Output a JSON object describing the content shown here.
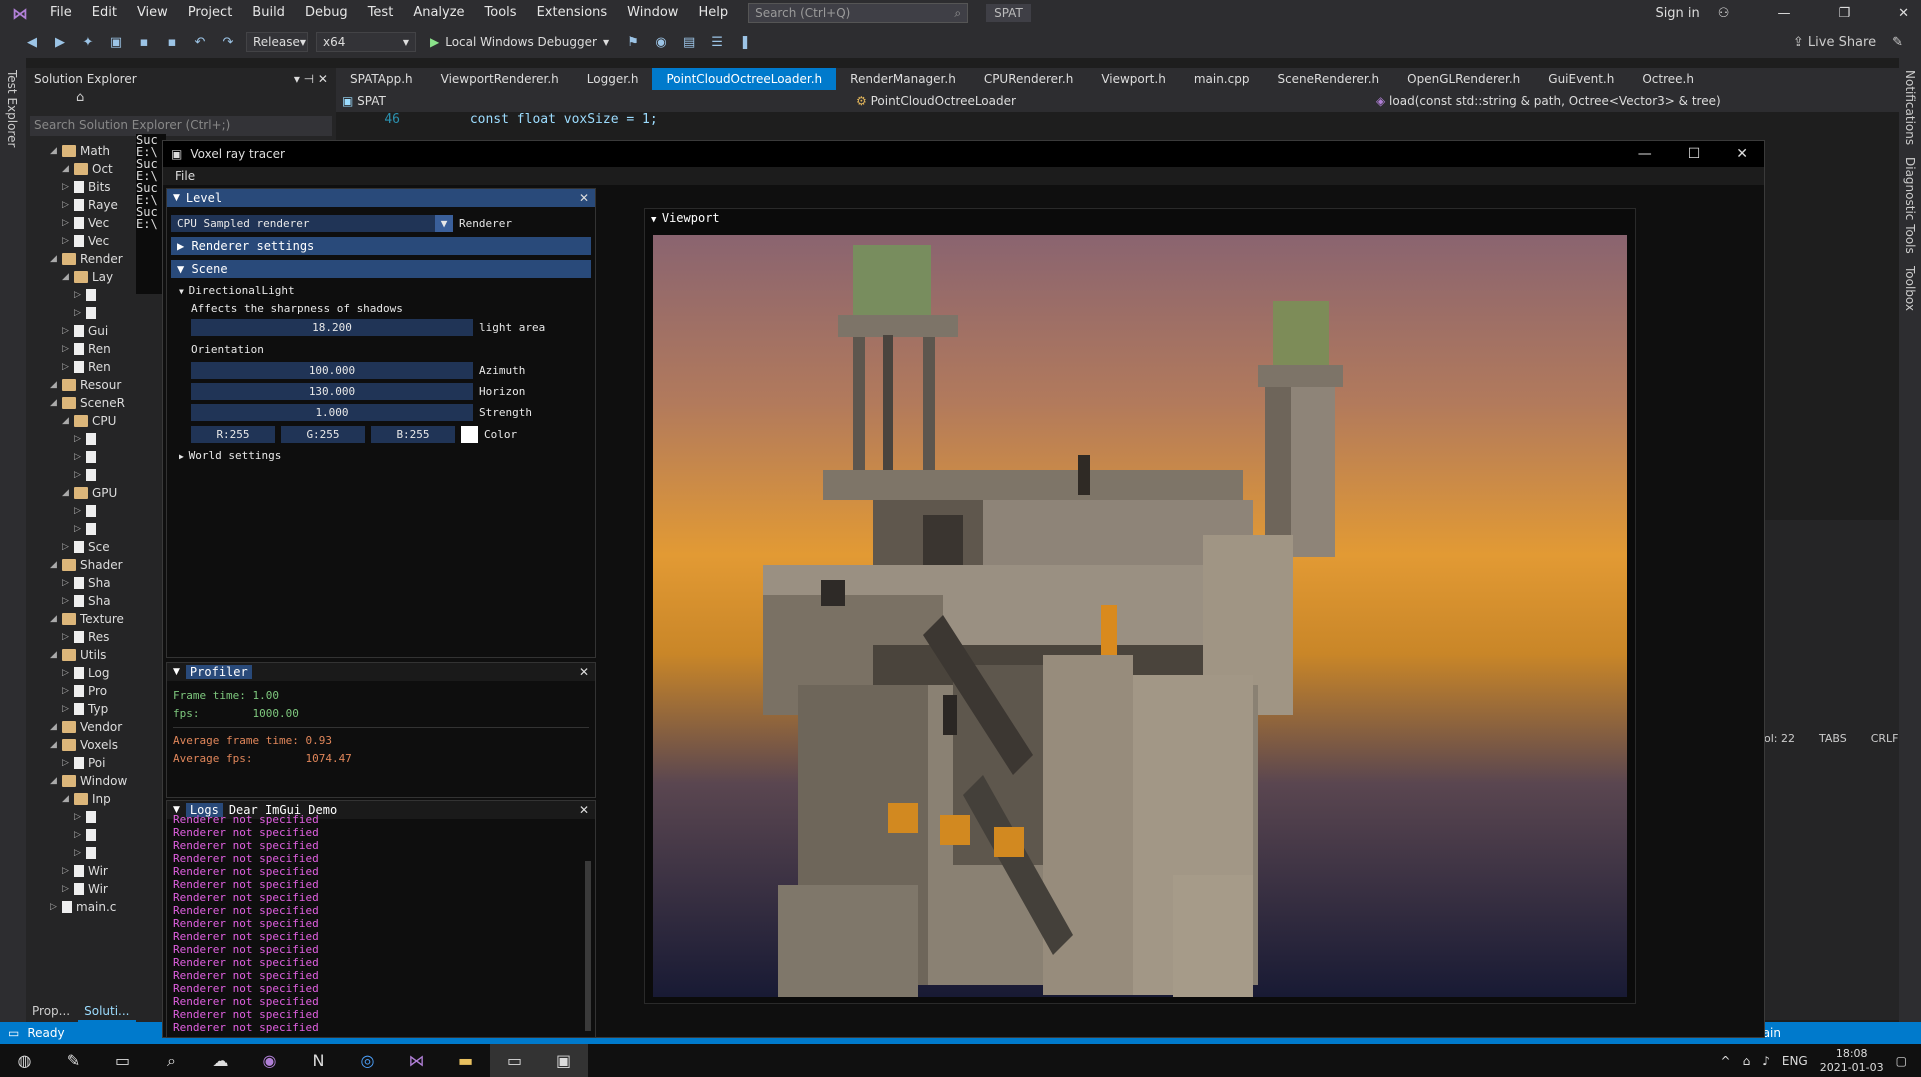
{
  "ide": {
    "menu": [
      "File",
      "Edit",
      "View",
      "Project",
      "Build",
      "Debug",
      "Test",
      "Analyze",
      "Tools",
      "Extensions",
      "Window",
      "Help"
    ],
    "search_placeholder": "Search (Ctrl+Q)",
    "project_name": "SPAT",
    "sign_in": "Sign in",
    "live_share": "Live Share",
    "config": "Release",
    "platform": "x64",
    "debugger": "Local Windows Debugger",
    "test_explorer": "Test Explorer",
    "right_strip": [
      "Notifications",
      "Diagnostic Tools",
      "Toolbox"
    ],
    "solution_explorer_title": "Solution Explorer",
    "solution_search": "Search Solution Explorer (Ctrl+;)",
    "tree": [
      {
        "label": "Math",
        "indent": 2,
        "folder": true
      },
      {
        "label": "Oct",
        "indent": 3,
        "folder": true
      },
      {
        "label": "Bits",
        "indent": 3,
        "folder": false
      },
      {
        "label": "Raye",
        "indent": 3,
        "folder": false
      },
      {
        "label": "Vec",
        "indent": 3,
        "folder": false
      },
      {
        "label": "Vec",
        "indent": 3,
        "folder": false
      },
      {
        "label": "Render",
        "indent": 2,
        "folder": true
      },
      {
        "label": "Lay",
        "indent": 3,
        "folder": true
      },
      {
        "label": "",
        "indent": 4,
        "folder": false
      },
      {
        "label": "",
        "indent": 4,
        "folder": false
      },
      {
        "label": "Gui",
        "indent": 3,
        "folder": false
      },
      {
        "label": "Ren",
        "indent": 3,
        "folder": false
      },
      {
        "label": "Ren",
        "indent": 3,
        "folder": false
      },
      {
        "label": "Resour",
        "indent": 2,
        "folder": true
      },
      {
        "label": "SceneR",
        "indent": 2,
        "folder": true
      },
      {
        "label": "CPU",
        "indent": 3,
        "folder": true
      },
      {
        "label": "",
        "indent": 4,
        "folder": false
      },
      {
        "label": "",
        "indent": 4,
        "folder": false
      },
      {
        "label": "",
        "indent": 4,
        "folder": false
      },
      {
        "label": "GPU",
        "indent": 3,
        "folder": true
      },
      {
        "label": "",
        "indent": 4,
        "folder": false
      },
      {
        "label": "",
        "indent": 4,
        "folder": false
      },
      {
        "label": "Sce",
        "indent": 3,
        "folder": false
      },
      {
        "label": "Shader",
        "indent": 2,
        "folder": true
      },
      {
        "label": "Sha",
        "indent": 3,
        "folder": false
      },
      {
        "label": "Sha",
        "indent": 3,
        "folder": false
      },
      {
        "label": "Texture",
        "indent": 2,
        "folder": true
      },
      {
        "label": "Res",
        "indent": 3,
        "folder": false
      },
      {
        "label": "Utils",
        "indent": 2,
        "folder": true
      },
      {
        "label": "Log",
        "indent": 3,
        "folder": false
      },
      {
        "label": "Pro",
        "indent": 3,
        "folder": false
      },
      {
        "label": "Typ",
        "indent": 3,
        "folder": false
      },
      {
        "label": "Vendor",
        "indent": 2,
        "folder": true
      },
      {
        "label": "Voxels",
        "indent": 2,
        "folder": true
      },
      {
        "label": "Poi",
        "indent": 3,
        "folder": false
      },
      {
        "label": "Window",
        "indent": 2,
        "folder": true
      },
      {
        "label": "Inp",
        "indent": 3,
        "folder": true
      },
      {
        "label": "",
        "indent": 4,
        "folder": false
      },
      {
        "label": "",
        "indent": 4,
        "folder": false
      },
      {
        "label": "",
        "indent": 4,
        "folder": false
      },
      {
        "label": "Wir",
        "indent": 3,
        "folder": false
      },
      {
        "label": "Wir",
        "indent": 3,
        "folder": false
      },
      {
        "label": "main.c",
        "indent": 2,
        "folder": false
      }
    ],
    "bottom_tabs": [
      "Prop...",
      "Soluti..."
    ],
    "console_lines": [
      "Suc",
      "E:\\",
      "Suc",
      "E:\\",
      "Suc",
      "E:\\",
      "Suc",
      "E:\\"
    ],
    "tabs": [
      "SPATApp.h",
      "ViewportRenderer.h",
      "Logger.h",
      "PointCloudOctreeLoader.h",
      "RenderManager.h",
      "CPURenderer.h",
      "Viewport.h",
      "main.cpp",
      "SceneRenderer.h",
      "OpenGLRenderer.h",
      "GuiEvent.h",
      "Octree.h"
    ],
    "active_tab": 3,
    "nav_project": "SPAT",
    "nav_class": "PointCloudOctreeLoader",
    "nav_member": "load(const std::string & path, Octree<Vector3> & tree)",
    "code_line_no": "46",
    "code_text": "const float voxSize = 1;",
    "editor_status": {
      "col": "ol: 22",
      "tabs": "TABS",
      "crlf": "CRLF"
    },
    "status": "Ready",
    "status_right": "ain"
  },
  "app": {
    "title": "Voxel ray tracer",
    "menu_file": "File",
    "level": {
      "header": "Level",
      "renderer_value": "CPU Sampled renderer",
      "renderer_label": "Renderer",
      "renderer_settings": "Renderer settings",
      "scene": "Scene",
      "directional_light": "DirectionalLight",
      "shadow_hint": "Affects the sharpness of shadows",
      "light_area_value": "18.200",
      "light_area_label": "light area",
      "orientation": "Orientation",
      "azimuth_value": "100.000",
      "azimuth_label": "Azimuth",
      "horizon_value": "130.000",
      "horizon_label": "Horizon",
      "strength_value": "1.000",
      "strength_label": "Strength",
      "r": "R:255",
      "g": "G:255",
      "b": "B:255",
      "color_label": "Color",
      "world_settings": "World settings"
    },
    "profiler": {
      "header": "Profiler",
      "frame_time": "Frame time: 1.00",
      "fps": "fps:        1000.00",
      "avg_frame_time": "Average frame time: 0.93",
      "avg_fps": "Average fps:        1074.47"
    },
    "logs": {
      "tab_logs": "Logs",
      "tab_demo": "Dear ImGui Demo",
      "line": "Renderer not specified",
      "count": 17
    },
    "viewport_title": "Viewport"
  },
  "taskbar": {
    "lang": "ENG",
    "time": "18:08",
    "date": "2021-01-03"
  },
  "colors": {
    "accent": "#007acc",
    "imgui_header": "#294a7a",
    "log_text": "#e060e0",
    "profiler_green": "#7ec87e",
    "profiler_orange": "#e0865a"
  }
}
